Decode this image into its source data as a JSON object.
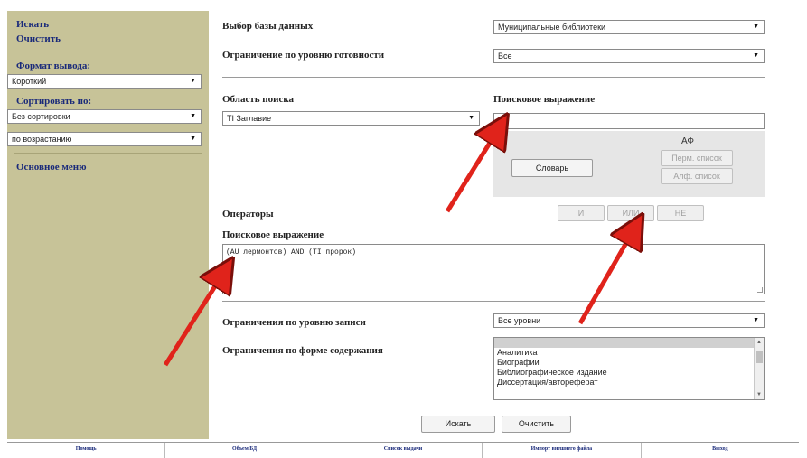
{
  "caption": "",
  "sidebar": {
    "search_link": "Искать",
    "clear_link": "Очистить",
    "output_format_label": "Формат вывода:",
    "output_format_value": "Короткий",
    "sort_label": "Сортировать по:",
    "sort_value": "Без сортировки",
    "sort_order_value": "по возрастанию",
    "main_menu_link": "Основное меню"
  },
  "main": {
    "database_label": "Выбор базы данных",
    "database_value": "Муниципальные библиотеки",
    "readiness_label": "Ограничение по уровню готовности",
    "readiness_value": "Все",
    "search_area_label": "Область поиска",
    "search_area_value": "TI Заглавие",
    "search_expr_label": "Поисковое выражение",
    "search_expr_value": "",
    "af_label": "АФ",
    "perm_list_button": "Перм. список",
    "alph_list_button": "Алф. список",
    "dictionary_button": "Словарь",
    "operators_label": "Операторы",
    "op_and": "И",
    "op_or": "ИЛИ",
    "op_not": "НЕ",
    "query_label": "Поисковое выражение",
    "query_value": "(AU лермонтов) AND (TI пророк)",
    "record_level_label": "Ограничения по уровню записи",
    "record_level_value": "Все уровни",
    "content_form_label": "Ограничения по форме содержания",
    "content_form_options": [
      "",
      "Аналитика",
      "Биографии",
      "Библиографическое издание",
      "Диссертация/автореферат"
    ],
    "search_button": "Искать",
    "clear_button": "Очистить"
  },
  "footer": {
    "items": [
      "Помощь",
      "Объем БД",
      "Список выдачи",
      "Импорт внешнего файла",
      "Выход"
    ]
  },
  "icons": {
    "dropdown": "chevron-down-icon"
  },
  "colors": {
    "sidebar_bg": "#c7c398",
    "link_color": "#1a2a7a",
    "arrow_color": "#e0231b"
  }
}
